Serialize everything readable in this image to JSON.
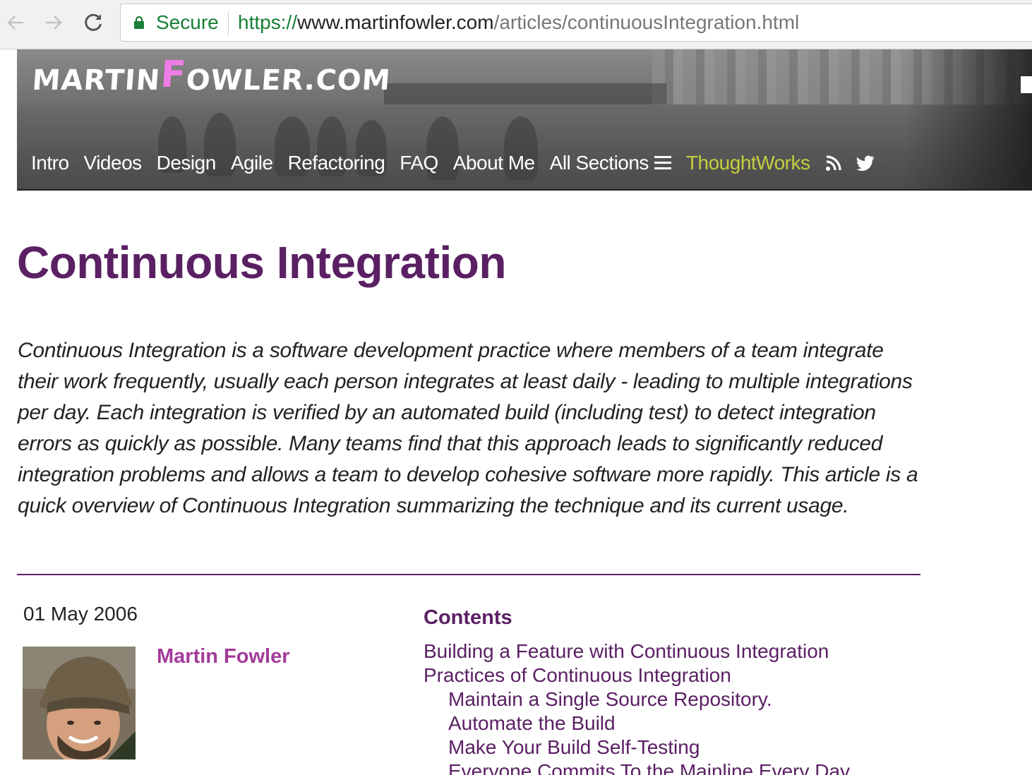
{
  "browser": {
    "secure_label": "Secure",
    "url_scheme": "https://",
    "url_host": "www.martinfowler.com",
    "url_path": "/articles/continuousIntegration.html"
  },
  "site": {
    "logo_pre": "MARTIN",
    "logo_accent": "F",
    "logo_post": "OWLER.COM",
    "nav": [
      "Intro",
      "Videos",
      "Design",
      "Agile",
      "Refactoring",
      "FAQ",
      "About Me",
      "All Sections"
    ],
    "thoughtworks": "ThoughtWorks",
    "icons": [
      "rss-icon",
      "twitter-icon"
    ],
    "colors": {
      "accent_pink": "#f07ce6",
      "thoughtworks_green": "#c4cf3e"
    }
  },
  "article": {
    "title": "Continuous Integration",
    "abstract": "Continuous Integration is a software development practice where members of a team integrate their work frequently, usually each person integrates at least daily - leading to multiple integrations per day. Each integration is verified by an automated build (including test) to detect integration errors as quickly as possible. Many teams find that this approach leads to significantly reduced integration problems and allows a team to develop cohesive software more rapidly. This article is a quick overview of Continuous Integration summarizing the technique and its current usage.",
    "date": "01 May 2006",
    "author": "Martin Fowler",
    "title_color": "#5a2063",
    "author_color": "#a33a9a"
  },
  "contents": {
    "heading": "Contents",
    "items": [
      {
        "label": "Building a Feature with Continuous Integration",
        "level": 1
      },
      {
        "label": "Practices of Continuous Integration",
        "level": 1
      },
      {
        "label": "Maintain a Single Source Repository.",
        "level": 2
      },
      {
        "label": "Automate the Build",
        "level": 2
      },
      {
        "label": "Make Your Build Self-Testing",
        "level": 2
      },
      {
        "label": "Everyone Commits To the Mainline Every Day",
        "level": 2
      }
    ]
  }
}
